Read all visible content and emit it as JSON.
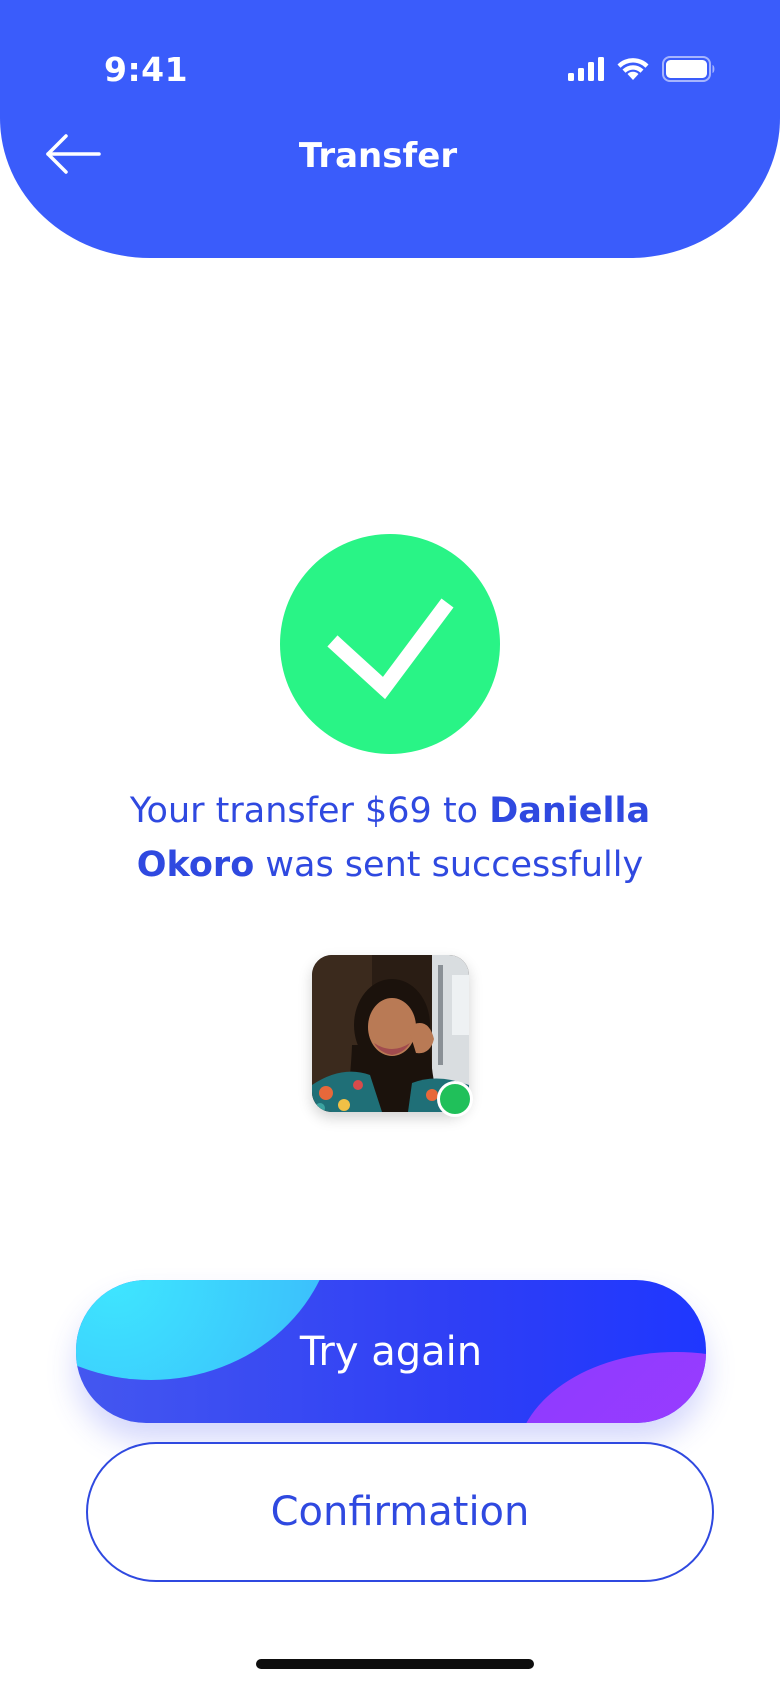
{
  "status_bar": {
    "time": "9:41",
    "icons": [
      "cellular-signal-icon",
      "wifi-icon",
      "battery-icon"
    ]
  },
  "header": {
    "back_icon": "arrow-left-icon",
    "title": "Transfer"
  },
  "success": {
    "icon": "checkmark-icon",
    "message_prefix": "Your transfer $69 to ",
    "recipient_name": "Daniella Okoro",
    "message_suffix": " was sent successfully"
  },
  "recipient": {
    "avatar_alt": "avatar",
    "status": "online"
  },
  "buttons": {
    "primary_label": "Try again",
    "secondary_label": "Confirmation"
  },
  "colors": {
    "brand_blue": "#3a5cfb",
    "success_green": "#29f486",
    "text_blue": "#2f49e0",
    "online_green": "#20c05a"
  }
}
